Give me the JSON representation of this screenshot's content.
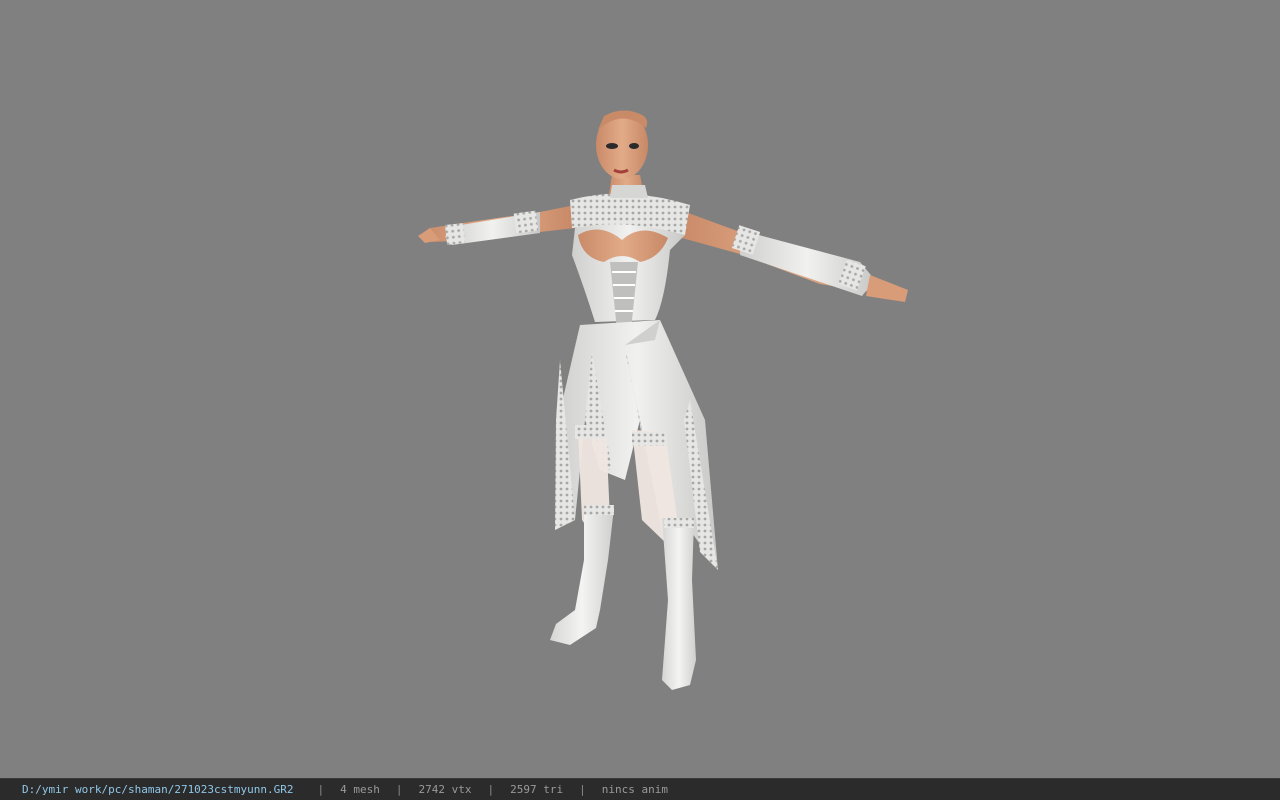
{
  "viewer": {
    "background_color": "#808080",
    "model": {
      "description_icon": "character-model",
      "skin_color": "#d9a07a",
      "outfit_color": "#e8e8e6",
      "lace_color": "#c9c9c9"
    }
  },
  "status_bar": {
    "file_path": "D:/ymir work/pc/shaman/271023cstmyunn.GR2",
    "separator": "|",
    "mesh_count": "4 mesh",
    "vertex_count": "2742 vtx",
    "triangle_count": "2597 tri",
    "animation": "nincs anim",
    "path_color": "#8fc7e8",
    "bar_color": "#2b2b2b"
  }
}
